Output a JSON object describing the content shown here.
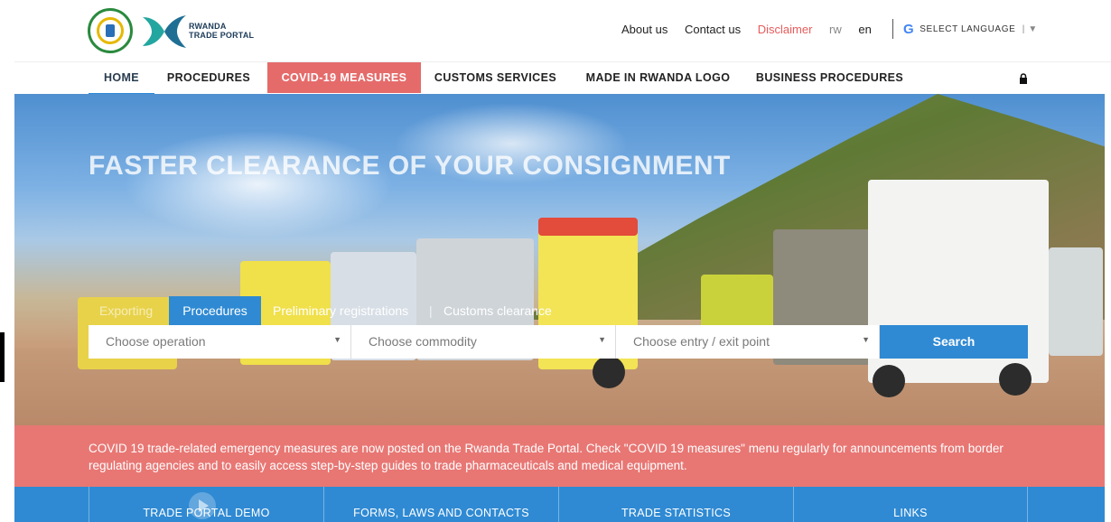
{
  "header": {
    "logo_text_line1": "RWANDA",
    "logo_text_line2": "TRADE PORTAL",
    "links": [
      "About us",
      "Contact us",
      "Disclaimer",
      "rw",
      "en"
    ],
    "select_language": "SELECT LANGUAGE",
    "select_language_caret": "▼",
    "google_glyph": "G",
    "google_icon": "google-icon"
  },
  "nav": {
    "items": [
      "HOME",
      "PROCEDURES",
      "COVID-19 MEASURES",
      "CUSTOMS SERVICES",
      "MADE IN RWANDA LOGO",
      "BUSINESS PROCEDURES"
    ],
    "active": "HOME",
    "lock_icon": "lock-icon"
  },
  "hero": {
    "title": "FASTER CLEARANCE OF YOUR CONSIGNMENT",
    "tabs": [
      "Exporting",
      "Procedures",
      "Preliminary registrations",
      "Customs clearance"
    ],
    "tab_separator": "|",
    "active_tab": "Procedures",
    "search": {
      "operation_placeholder": "Choose operation",
      "commodity_placeholder": "Choose commodity",
      "entry_exit_placeholder": "Choose entry / exit point",
      "caret": "▼",
      "button": "Search"
    }
  },
  "notice": {
    "text": "COVID 19 trade-related emergency measures are now posted on the Rwanda Trade Portal. Check \"COVID 19 measures\" menu regularly for announcements from border regulating agencies and to easily access step-by-step guides to trade pharmaceuticals and medical equipment."
  },
  "bottom": {
    "items": [
      "TRADE PORTAL DEMO",
      "FORMS, LAWS AND CONTACTS",
      "TRADE STATISTICS",
      "LINKS"
    ]
  },
  "colors": {
    "accent_blue": "#2f8ad3",
    "covid_red": "#e56b6b",
    "notice_red": "#e87774",
    "disclaimer": "#e85b5b"
  }
}
